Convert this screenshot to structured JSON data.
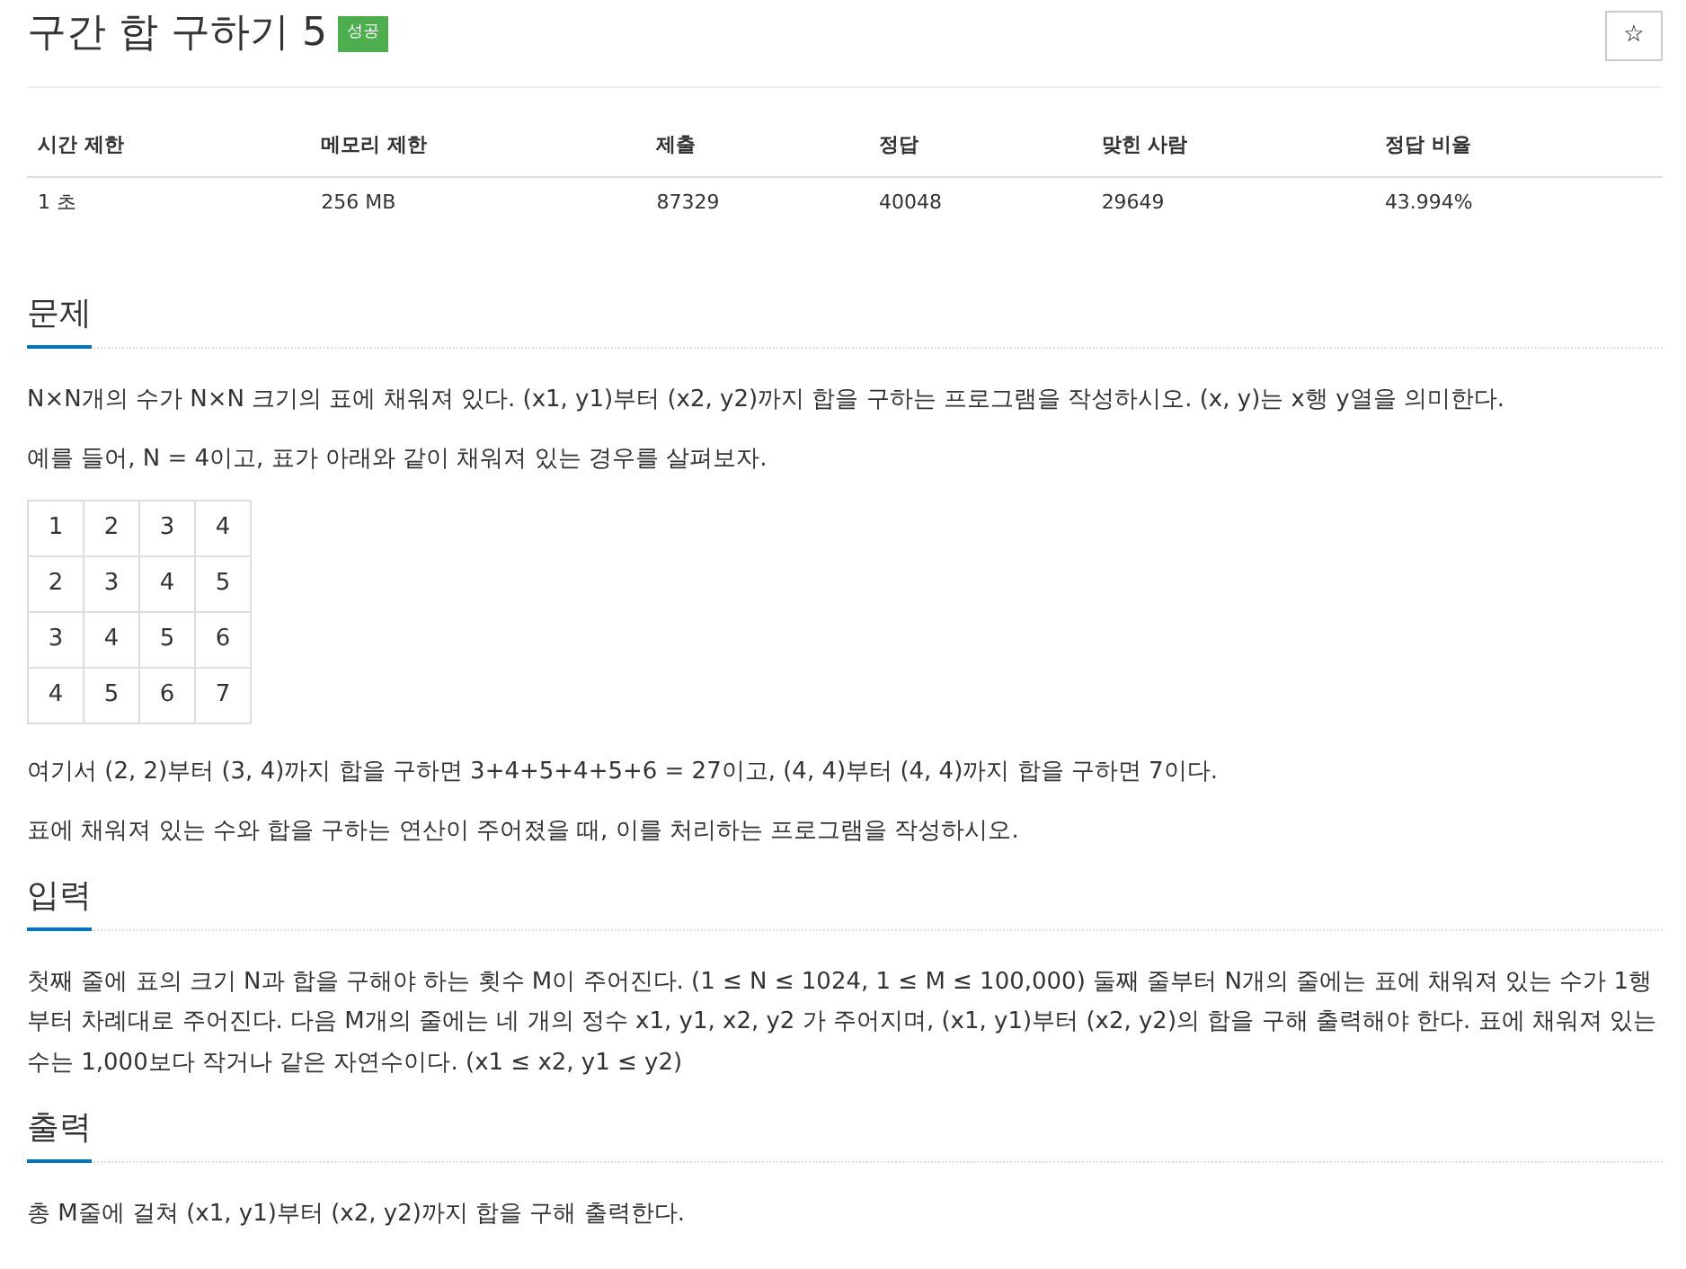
{
  "title": "구간 합 구하기 5",
  "badge": "성공",
  "star_button": "☆",
  "info_table": {
    "columns": [
      "시간 제한",
      "메모리 제한",
      "제출",
      "정답",
      "맞힌 사람",
      "정답 비율"
    ],
    "rows": [
      [
        "1 초",
        "256 MB",
        "87329",
        "40048",
        "29649",
        "43.994%"
      ]
    ]
  },
  "sections": [
    {
      "heading": "문제",
      "blocks": [
        {
          "kind": "text",
          "text": "N×N개의 수가 N×N 크기의 표에 채워져 있다. (x1, y1)부터 (x2, y2)까지 합을 구하는 프로그램을 작성하시오. (x, y)는 x행 y열을 의미한다."
        },
        {
          "kind": "text",
          "text": "예를 들어, N = 4이고, 표가 아래와 같이 채워져 있는 경우를 살펴보자."
        },
        {
          "kind": "grid",
          "rows": [
            [
              "1",
              "2",
              "3",
              "4"
            ],
            [
              "2",
              "3",
              "4",
              "5"
            ],
            [
              "3",
              "4",
              "5",
              "6"
            ],
            [
              "4",
              "5",
              "6",
              "7"
            ]
          ]
        },
        {
          "kind": "text",
          "text": "여기서 (2, 2)부터 (3, 4)까지 합을 구하면 3+4+5+4+5+6 = 27이고, (4, 4)부터 (4, 4)까지 합을 구하면 7이다."
        },
        {
          "kind": "text",
          "text": "표에 채워져 있는 수와 합을 구하는 연산이 주어졌을 때, 이를 처리하는 프로그램을 작성하시오."
        }
      ]
    },
    {
      "heading": "입력",
      "blocks": [
        {
          "kind": "text",
          "text": "첫째 줄에 표의 크기 N과 합을 구해야 하는 횟수 M이 주어진다. (1 ≤ N ≤ 1024, 1 ≤ M ≤ 100,000) 둘째 줄부터 N개의 줄에는 표에 채워져 있는 수가 1행부터 차례대로 주어진다. 다음 M개의 줄에는 네 개의 정수 x1, y1, x2, y2 가 주어지며, (x1, y1)부터 (x2, y2)의 합을 구해 출력해야 한다. 표에 채워져 있는 수는 1,000보다 작거나 같은 자연수이다. (x1 ≤ x2, y1 ≤ y2)"
        }
      ]
    },
    {
      "heading": "출력",
      "blocks": [
        {
          "kind": "text",
          "text": "총 M줄에 걸쳐 (x1, y1)부터 (x2, y2)까지 합을 구해 출력한다."
        }
      ]
    }
  ]
}
